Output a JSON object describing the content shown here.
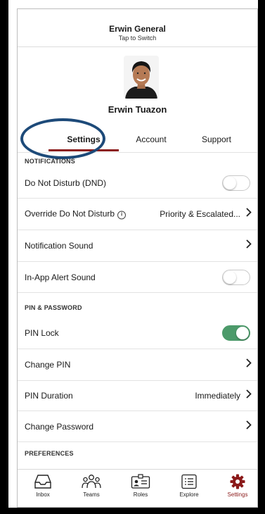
{
  "header": {
    "title": "Erwin General",
    "subtitle": "Tap to Switch"
  },
  "profile": {
    "name": "Erwin Tuazon"
  },
  "tabs": [
    {
      "label": "Settings",
      "active": true
    },
    {
      "label": "Account",
      "active": false
    },
    {
      "label": "Support",
      "active": false
    }
  ],
  "sections": {
    "notifications": {
      "header": "NOTIFICATIONS",
      "rows": [
        {
          "label": "Do Not Disturb (DND)",
          "toggle": false
        },
        {
          "label": "Override Do Not Disturb",
          "info_icon": "info-icon",
          "value": "Priority & Escalated..."
        },
        {
          "label": "Notification Sound"
        },
        {
          "label": "In-App Alert Sound",
          "toggle": false
        }
      ]
    },
    "pin_password": {
      "header": "PIN & PASSWORD",
      "rows": [
        {
          "label": "PIN Lock",
          "toggle": true
        },
        {
          "label": "Change PIN"
        },
        {
          "label": "PIN Duration",
          "value": "Immediately"
        },
        {
          "label": "Change Password"
        }
      ]
    },
    "preferences": {
      "header": "PREFERENCES"
    }
  },
  "tabbar": [
    {
      "label": "Inbox",
      "icon": "inbox-icon"
    },
    {
      "label": "Teams",
      "icon": "teams-icon"
    },
    {
      "label": "Roles",
      "icon": "roles-icon"
    },
    {
      "label": "Explore",
      "icon": "explore-icon"
    },
    {
      "label": "Settings",
      "icon": "gear-icon",
      "active": true
    }
  ],
  "colors": {
    "accent": "#8b1a1a",
    "toggle_on": "#4c9a6a",
    "annotation_circle": "#1d4a79"
  }
}
